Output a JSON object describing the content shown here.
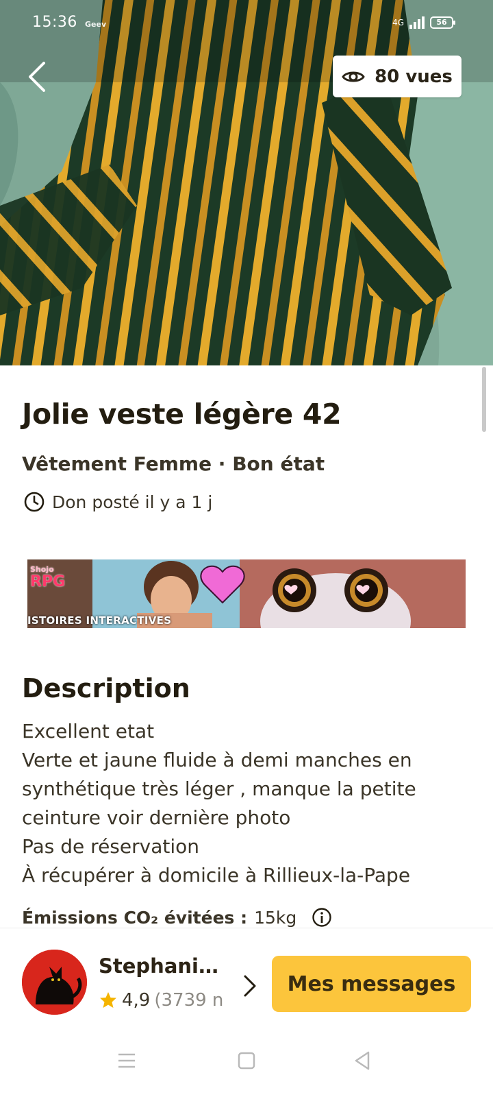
{
  "status_bar": {
    "time": "15:36",
    "carrier": "Geev",
    "network": "4G",
    "battery": "56"
  },
  "header": {
    "back_icon": "chevron-left-icon",
    "views_icon": "eye-icon",
    "views_label": "80 vues"
  },
  "item": {
    "title": "Jolie veste légère 42",
    "subtitle": "Vêtement Femme · Bon état",
    "posted_icon": "clock-icon",
    "posted": "Don posté il y a 1 j"
  },
  "ad": {
    "logo_top": "Shojo",
    "logo_main": "RPG",
    "caption": "ISTOIRES INTERACTIVES"
  },
  "description": {
    "heading": "Description",
    "lines": [
      "Excellent etat",
      "Verte et jaune fluide à demi manches en",
      "synthétique très léger , manque la petite",
      "ceinture voir dernière photo",
      "Pas de réservation",
      "À récupérer à domicile à Rillieux-la-Pape"
    ],
    "co2_label": "Émissions CO₂ évitées :",
    "co2_value": "15kg"
  },
  "seller": {
    "name": "Stephanie…",
    "rating": "4,9",
    "reviews": "(3739 n"
  },
  "actions": {
    "messages": "Mes messages"
  },
  "colors": {
    "accent": "#fcc53c",
    "star": "#f5b400",
    "text_dark": "#231d10"
  }
}
